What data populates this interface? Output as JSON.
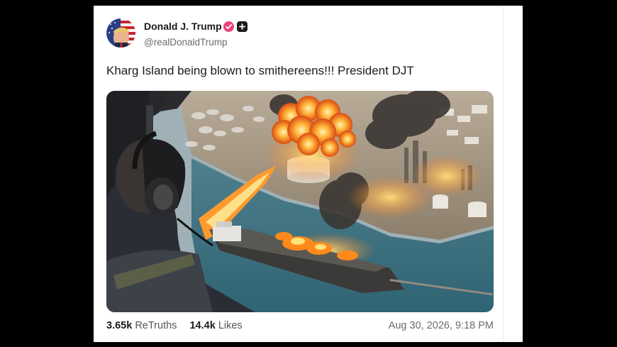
{
  "post": {
    "author_name": "Donald J. Trump",
    "author_handle": "@realDonaldTrump",
    "verified_icon": "verified-badge-icon",
    "extra_icon": "plus-badge-icon",
    "text": "Kharg Island being blown to smithereens!!! President DJT",
    "image_icon": "explosion-scene-image",
    "retruths_count": "3.65k",
    "retruths_label": "ReTruths",
    "likes_count": "14.4k",
    "likes_label": "Likes",
    "timestamp": "Aug 30, 2026, 9:18 PM"
  },
  "colors": {
    "verified": "#e8457a",
    "background": "#000000",
    "card": "#ffffff"
  }
}
